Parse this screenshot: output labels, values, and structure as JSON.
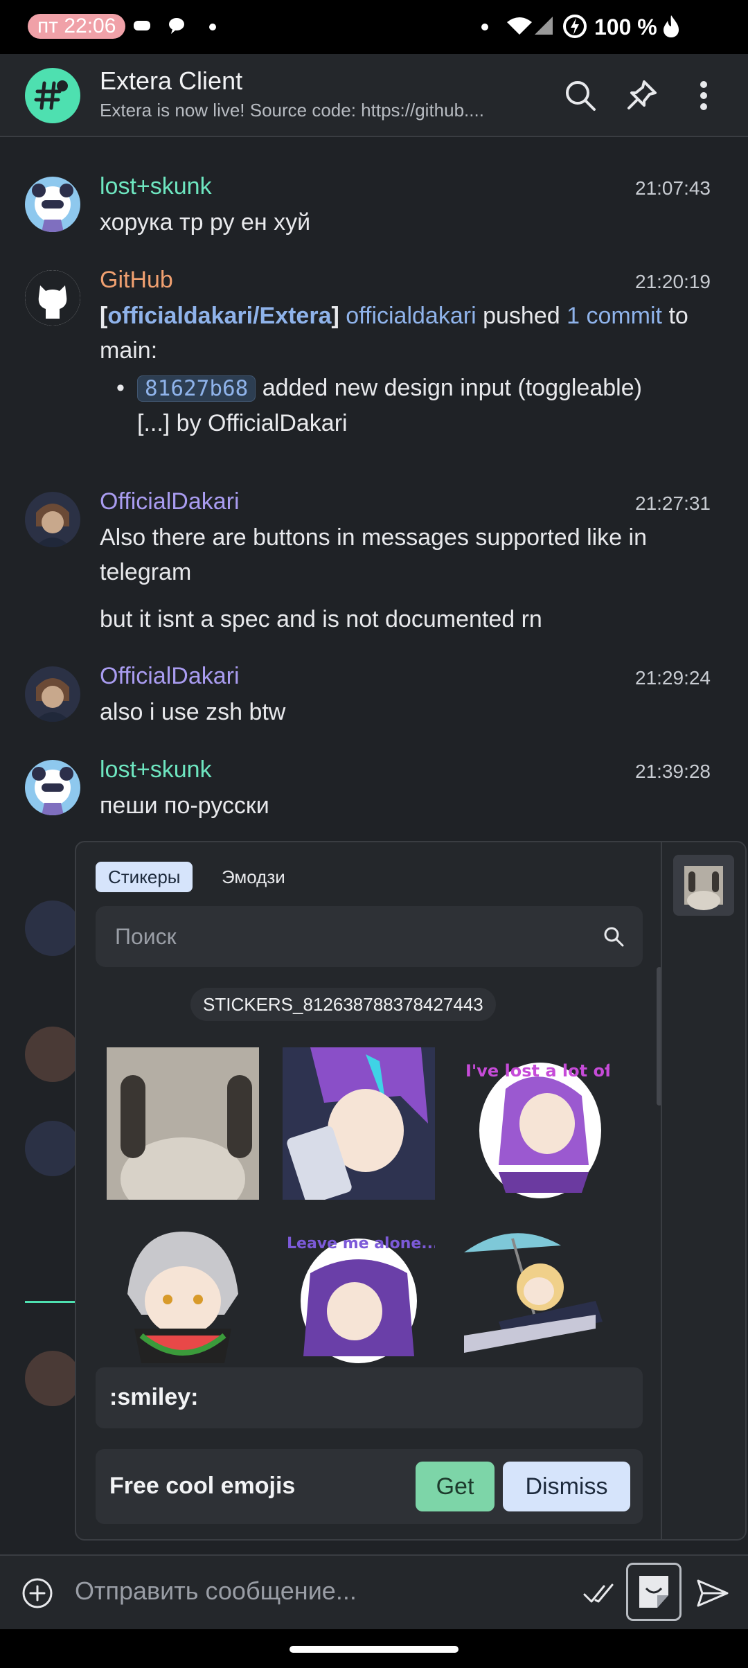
{
  "status_bar": {
    "time": "пт 22:06",
    "battery": "100 %"
  },
  "header": {
    "title": "Extera Client",
    "topic": "Extera is now live! Source code: https://github...."
  },
  "messages": [
    {
      "sender": "lost+skunk",
      "sender_color": "#6ee6c0",
      "time": "21:07:43",
      "text": "хорука тр ру ен хуй"
    },
    {
      "sender": "GitHub",
      "sender_color": "#f0a070",
      "time": "21:20:19",
      "repo": "officialdakari/Extera",
      "actor": "officialdakari",
      "action": "pushed",
      "commits": "1 commit",
      "to": "to main:",
      "commit_hash": "81627b68",
      "commit_msg": "added new design input (toggleable)",
      "commit_by": "[...] by OfficialDakari"
    },
    {
      "sender": "OfficialDakari",
      "sender_color": "#a99cf0",
      "time": "21:27:31",
      "text": "Also there are buttons in messages supported like in telegram",
      "text2": "but it isnt a spec and is not documented rn"
    },
    {
      "sender": "OfficialDakari",
      "sender_color": "#a99cf0",
      "time": "21:29:24",
      "text": "also i use zsh btw"
    },
    {
      "sender": "lost+skunk",
      "sender_color": "#6ee6c0",
      "time": "21:39:28",
      "text": "пеши по-русски"
    }
  ],
  "picker": {
    "tabs": [
      "Стикеры",
      "Эмодзи"
    ],
    "search_placeholder": "Поиск",
    "pack_name": "STICKERS_812638788378427443",
    "stickers": [
      "cat-sticker",
      "anime-phone-sticker",
      "lost-money-sticker",
      "watermelon-sticker",
      "leave-me-alone-sticker",
      "beach-sticker"
    ],
    "sticker_texts": {
      "lost_money": "I've lost a lot of money",
      "leave_alone": "Leave me alone..."
    },
    "shortcode": ":smiley:",
    "promo": {
      "text": "Free cool emojis",
      "get": "Get",
      "dismiss": "Dismiss"
    }
  },
  "composer": {
    "placeholder": "Отправить сообщение..."
  }
}
